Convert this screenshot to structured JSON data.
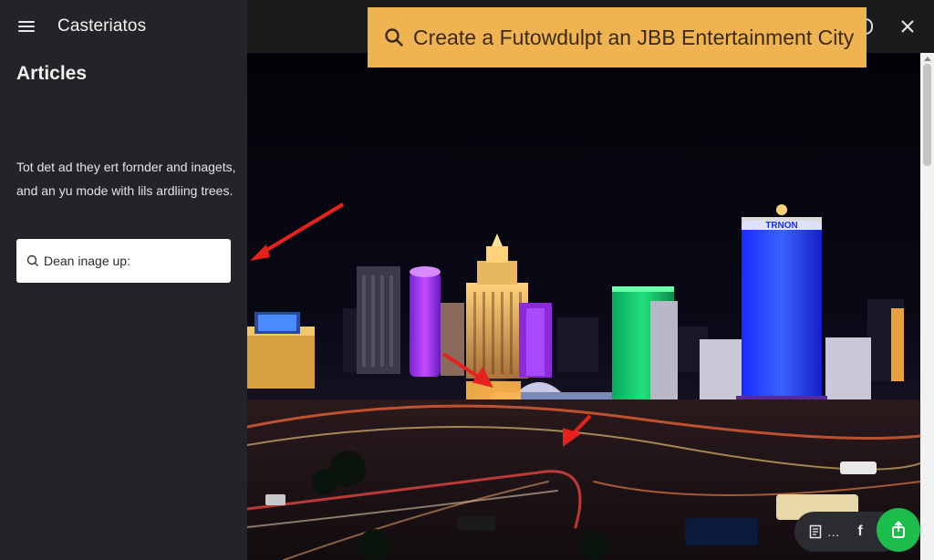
{
  "app": {
    "title": "Casteriatos"
  },
  "sidebar": {
    "section_title": "Articles",
    "description_lines": [
      "Tot det ad they ert fornder and inagets,",
      "and an yu mode with lils ardliing trees."
    ],
    "search": {
      "value": "Dean inage up:"
    }
  },
  "prompt": {
    "text": "Create a Futowdulpt an JBB Entertainment City"
  },
  "image": {
    "billboard_text": "TRNON"
  },
  "toolbar": {
    "dots_label": "...",
    "facebook_label": "f"
  },
  "colors": {
    "sidebar_bg": "#232427",
    "banner_bg": "#f0b352",
    "fab_bg": "#1cbc4d",
    "arrow": "#e8201e",
    "toolbar_bg": "#2a2c2f"
  },
  "icons": [
    "menu-icon",
    "search-icon",
    "close-icon",
    "document-icon",
    "facebook-icon",
    "share-icon",
    "arrow-icon"
  ]
}
